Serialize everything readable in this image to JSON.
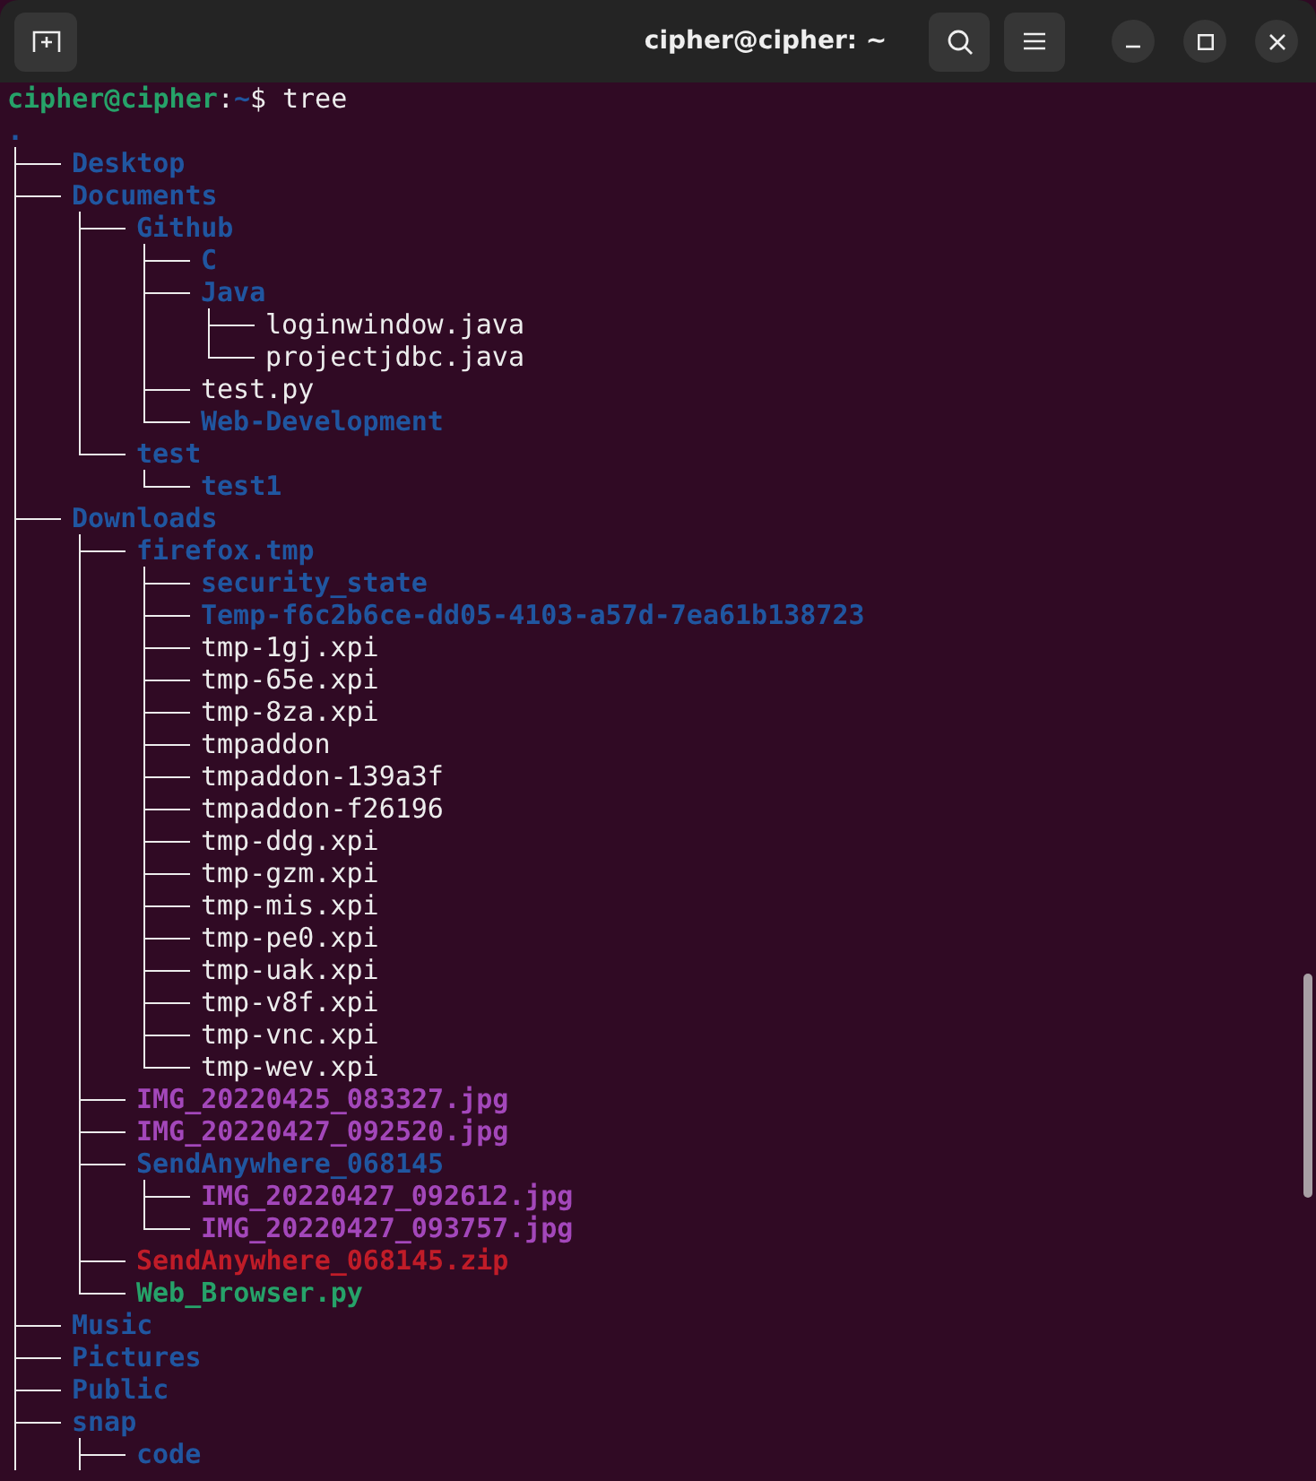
{
  "window": {
    "title": "cipher@cipher: ~"
  },
  "prompt": {
    "user": "cipher@cipher",
    "separator": ":",
    "path": "~",
    "symbol": "$",
    "command": "tree"
  },
  "tree": {
    "root": ".",
    "continues": true,
    "children": [
      {
        "name": "Desktop",
        "kind": "dir"
      },
      {
        "name": "Documents",
        "kind": "dir",
        "children": [
          {
            "name": "Github",
            "kind": "dir",
            "children": [
              {
                "name": "C",
                "kind": "dir"
              },
              {
                "name": "Java",
                "kind": "dir",
                "children": [
                  {
                    "name": "loginwindow.java",
                    "kind": "file"
                  },
                  {
                    "name": "projectjdbc.java",
                    "kind": "file"
                  }
                ]
              },
              {
                "name": "test.py",
                "kind": "file"
              },
              {
                "name": "Web-Development",
                "kind": "dir"
              }
            ]
          },
          {
            "name": "test",
            "kind": "dir",
            "children": [
              {
                "name": "test1",
                "kind": "dir"
              }
            ]
          }
        ]
      },
      {
        "name": "Downloads",
        "kind": "dir",
        "children": [
          {
            "name": "firefox.tmp",
            "kind": "dir",
            "children": [
              {
                "name": "security_state",
                "kind": "dir"
              },
              {
                "name": "Temp-f6c2b6ce-dd05-4103-a57d-7ea61b138723",
                "kind": "dir"
              },
              {
                "name": "tmp-1gj.xpi",
                "kind": "file"
              },
              {
                "name": "tmp-65e.xpi",
                "kind": "file"
              },
              {
                "name": "tmp-8za.xpi",
                "kind": "file"
              },
              {
                "name": "tmpaddon",
                "kind": "file"
              },
              {
                "name": "tmpaddon-139a3f",
                "kind": "file"
              },
              {
                "name": "tmpaddon-f26196",
                "kind": "file"
              },
              {
                "name": "tmp-ddg.xpi",
                "kind": "file"
              },
              {
                "name": "tmp-gzm.xpi",
                "kind": "file"
              },
              {
                "name": "tmp-mis.xpi",
                "kind": "file"
              },
              {
                "name": "tmp-pe0.xpi",
                "kind": "file"
              },
              {
                "name": "tmp-uak.xpi",
                "kind": "file"
              },
              {
                "name": "tmp-v8f.xpi",
                "kind": "file"
              },
              {
                "name": "tmp-vnc.xpi",
                "kind": "file"
              },
              {
                "name": "tmp-wev.xpi",
                "kind": "file"
              }
            ]
          },
          {
            "name": "IMG_20220425_083327.jpg",
            "kind": "image"
          },
          {
            "name": "IMG_20220427_092520.jpg",
            "kind": "image"
          },
          {
            "name": "SendAnywhere_068145",
            "kind": "dir",
            "children": [
              {
                "name": "IMG_20220427_092612.jpg",
                "kind": "image"
              },
              {
                "name": "IMG_20220427_093757.jpg",
                "kind": "image"
              }
            ]
          },
          {
            "name": "SendAnywhere_068145.zip",
            "kind": "archive"
          },
          {
            "name": "Web_Browser.py",
            "kind": "exec"
          }
        ]
      },
      {
        "name": "Music",
        "kind": "dir"
      },
      {
        "name": "Pictures",
        "kind": "dir"
      },
      {
        "name": "Public",
        "kind": "dir"
      },
      {
        "name": "snap",
        "kind": "dir",
        "children": [
          {
            "name": "code",
            "kind": "dir"
          }
        ]
      }
    ]
  }
}
